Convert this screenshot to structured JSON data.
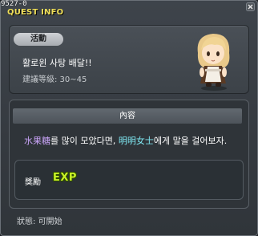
{
  "window": {
    "id": "9527-0",
    "title": "QUEST INFO"
  },
  "info": {
    "category": "活動",
    "quest_name": "활로윈 사탕 배달!!",
    "level_label": "建議等級: 30~45"
  },
  "content": {
    "header": "內容",
    "text_parts": [
      "水果糖",
      "를 많이 모았다면, ",
      "明明女士",
      "에게 말을 걸어보자."
    ]
  },
  "reward": {
    "label": "獎勵",
    "badge": "EXP"
  },
  "status": "狀態: 可開始",
  "colors": {
    "title": "#f0e05a",
    "highlight_item": "#c7a2f5",
    "highlight_npc": "#7fe8f2",
    "exp": "#c9f227"
  }
}
